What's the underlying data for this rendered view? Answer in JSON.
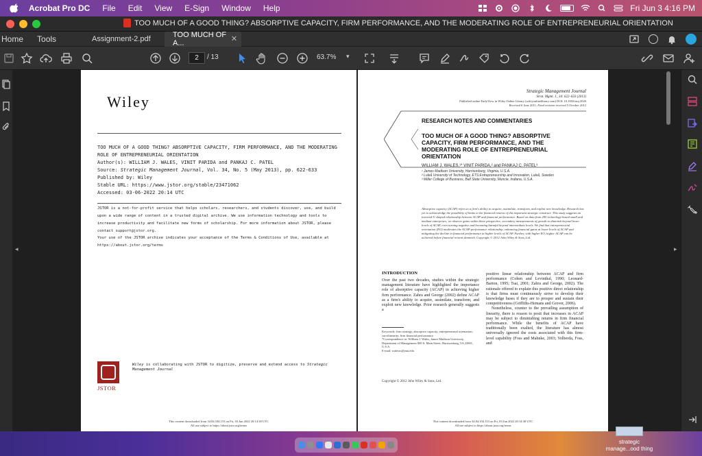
{
  "menubar": {
    "app": "Acrobat Pro DC",
    "items": [
      "File",
      "Edit",
      "View",
      "E-Sign",
      "Window",
      "Help"
    ],
    "datetime": "Fri Jun 3  4:16 PM"
  },
  "window": {
    "title": "TOO MUCH OF A GOOD THING? ABSORPTIVE CAPACITY, FIRM PERFORMANCE, AND THE MODERATING ROLE OF ENTREPRENEURIAL ORIENTATION"
  },
  "tabs": {
    "home": "Home",
    "tools": "Tools",
    "documents": [
      {
        "label": "Assignment-2.pdf"
      },
      {
        "label": "TOO MUCH OF A..."
      }
    ]
  },
  "toolbar": {
    "current_page": "2",
    "total_pages": "/ 13",
    "zoom": "63.7%"
  },
  "page1": {
    "publisher": "Wiley",
    "meta": {
      "title": "TOO MUCH OF A GOOD THING? ABSORPTIVE CAPACITY, FIRM PERFORMANCE, AND THE MODERATING ROLE OF ENTREPRENEURIAL ORIENTATION",
      "authors": "Author(s): WILLIAM J. WALES, VINIT PARIDA and  PANKAJ C. PATEL",
      "source_prefix": "Source: ",
      "source_journal": "Strategic Management Journal",
      "source_rest": ", Vol. 34, No. 5 (May 2013), pp. 622-633",
      "published": "Published by: Wiley",
      "stable_url": "Stable URL: https://www.jstor.org/stable/23471062",
      "accessed": "Accessed: 03-06-2022 20:14 UTC"
    },
    "note1": "JSTOR is a not-for-profit service that helps scholars, researchers, and students discover, use, and build upon a wide range of content in a trusted digital archive. We use information technology and tools to increase productivity and facilitate new forms of scholarship. For more information about JSTOR, please contact support@jstor.org.",
    "note2": "Your use of the JSTOR archive indicates your acceptance of the Terms & Conditions of Use, available at https://about.jstor.org/terms",
    "jstor_word": "JSTOR",
    "collab_pub": "Wiley",
    "collab_mid": " is collaborating with JSTOR to digitize, preserve and extend access to ",
    "collab_journal": "Strategic Management Journal",
    "footer1": "This content downloaded from 34.84.104.153 on Fri, 03 Jun 2022 20:14:38 UTC",
    "footer2": "All use subject to https://about.jstor.org/terms"
  },
  "page2": {
    "journal": "Strategic Management Journal",
    "citation": "Strat. Mgmt. J., 34: 622–633 (2013)",
    "published_online": "Published online EarlyView in Wiley Online Library (wileyonlinelibrary.com) DOI: 10.1002/smj.2026",
    "received": "Received 6 June 2011; Final revision received 5 October 2012",
    "section": "RESEARCH NOTES AND COMMENTARIES",
    "title": "TOO MUCH OF A GOOD THING? ABSORPTIVE CAPACITY, FIRM PERFORMANCE, AND THE MODERATING ROLE OF ENTREPRENEURIAL ORIENTATION",
    "authors": "WILLIAM J. WALES,¹* VINIT PARIDA,² and PANKAJ C. PATEL³",
    "affiliations": [
      "¹ James Madison University, Harrisonburg, Virginia, U.S.A.",
      "² Luleå University of Technology, ETS:Entrepreneurship and Innovation,  Luleå, Sweden",
      "³ Miller College of Business, Ball State University,  Muncie, Indiana, U.S.A."
    ],
    "abstract": "Absorptive capacity (ACAP) refers to a firm's ability to acquire, assimilate, transform, and exploit new knowledge. Research has yet to acknowledge the possibility of limits to the financial returns of this important strategic construct. This study suggests an inverted-U shaped relationship between ACAP and financial performance. Based on data from 285 technology-based small and medium enterprises, we observe gains within three prospective, secondary measurements of growth to diminish beyond lower levels of ACAP, even turning negative and becoming harmful beyond intermediate levels. We find that entrepreneurial orientation (EO) moderates the ACAP-performance relationship, enhancing financial gains at lower levels of ACAP and mitigating the decline in financial performance at higher levels of ACAP. Further, with higher EO, higher ACAP can be achieved before financial returns diminish.  Copyright © 2012 John Wiley & Sons, Ltd.",
    "intro_heading": "INTRODUCTION",
    "col_left": "Over the past two decades, studies within the strategic management literature have highlighted the importance role of absorptive capacity (ACAP) in achieving higher firm performance. Zahra and George (2002) define ACAP as a firm's ability to acquire, assimilate, transform, and exploit new knowledge. Prior research generally suggests a",
    "col_right_1": "positive linear relationship between ACAP and firm performance (Cohen and Levinthal, 1990; Leonard-Barton, 1995; Tsai, 2001; Zahra and George, 2002). The rationale offered to explain this positive direct relationship is that firms must continuously strive to develop their knowledge bases if they are to prosper and sustain their competitiveness (Griffiths-Hemans and Grover, 2006).",
    "col_right_2": "Nonetheless, counter to the prevailing assumption of linearity, there is reason to posit that increases in ACAP may be subject to diminishing returns in firm financial performance. While the benefits of ACAP have traditionally been exalted, the literature has almost universally ignored the costs associated with this firm-level capability (Foss and Mahnke, 2003; Volberda, Foss, and",
    "keywords": "Keywords: firm strategy; absorptive capacity; entrepreneurial orientation; curvilinearity; firm financial performance",
    "correspondence": "*Correspondence to: William J. Wales, James Madison University, Department of Management 800 S. Main Street, Harrisonburg, VA 22801, U.S.A.",
    "email": "E-mail: walesw@jmu.edu",
    "copyright": "Copyright © 2012 John Wiley & Sons, Ltd.",
    "footer1": "This content downloaded from 34.84.104.153 on Fri, 03 Jun 2022 20:14:38 UTC",
    "footer2": "All use subject to https://about.jstor.org/terms"
  },
  "desktop": {
    "file_label_1": "strategic",
    "file_label_2": "manage...ood thing"
  }
}
